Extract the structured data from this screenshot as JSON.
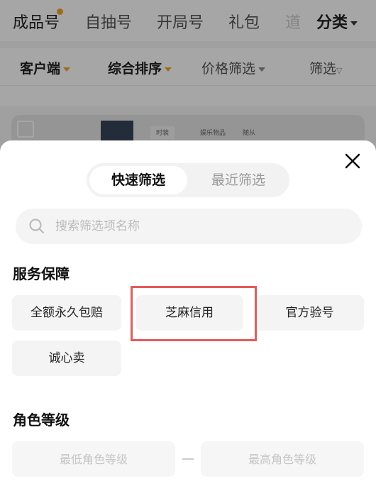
{
  "top_tabs": {
    "items": [
      {
        "label": "成品号"
      },
      {
        "label": "自抽号"
      },
      {
        "label": "开局号"
      },
      {
        "label": "礼包"
      },
      {
        "label": "道"
      }
    ],
    "category_label": "分类"
  },
  "filter_bar": {
    "client": "客户端",
    "sort": "综合排序",
    "price": "价格筛选",
    "filter": "筛选"
  },
  "background_card": {
    "labels": [
      "时装",
      "娱乐物品",
      "随从"
    ]
  },
  "sheet": {
    "segments": {
      "quick": "快速筛选",
      "recent": "最近筛选"
    },
    "search": {
      "placeholder": "搜索筛选项名称"
    },
    "service_section": {
      "title": "服务保障",
      "options": [
        "全额永久包赔",
        "芝麻信用",
        "官方验号",
        "诚心卖"
      ]
    },
    "level_section": {
      "title": "角色等级",
      "min_placeholder": "最低角色等级",
      "max_placeholder": "最高角色等级",
      "separator": "—"
    }
  },
  "colors": {
    "accent": "#f5a623",
    "highlight": "#e55b5b",
    "option_bg": "#f4f4f4"
  }
}
